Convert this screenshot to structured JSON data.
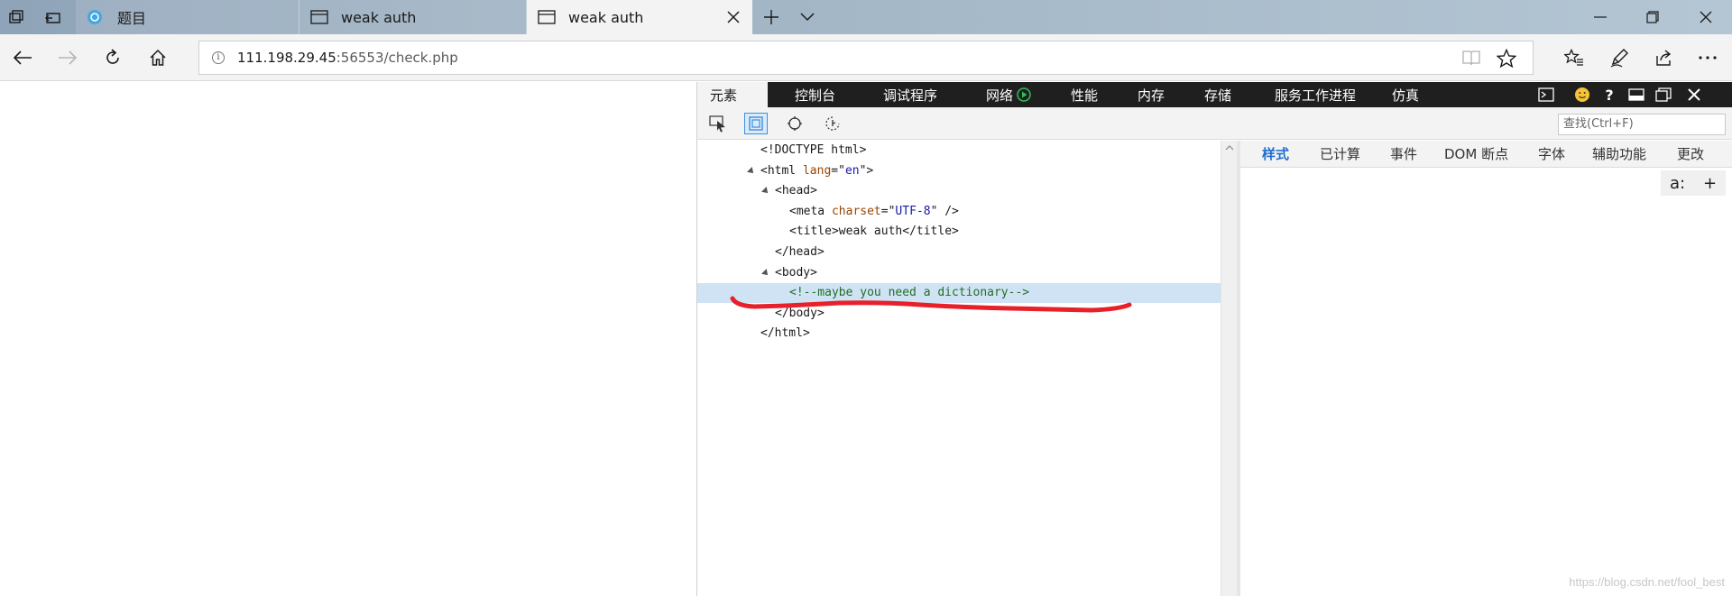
{
  "browser": {
    "tabs": [
      {
        "title": "题目",
        "active": false
      },
      {
        "title": "weak auth",
        "active": false
      },
      {
        "title": "weak auth",
        "active": true
      }
    ],
    "url_host": "111.198.29.45",
    "url_rest": ":56553/check.php",
    "window_controls": [
      "minimize-icon",
      "restore-icon",
      "close-icon"
    ]
  },
  "devtools": {
    "tabs": [
      "元素",
      "控制台",
      "调试程序",
      "网络",
      "性能",
      "内存",
      "存储",
      "服务工作进程",
      "仿真"
    ],
    "active_tab": "元素",
    "search_placeholder": "查找(Ctrl+F)",
    "dom": [
      {
        "indent": 0,
        "twisty": false,
        "parts": [
          [
            "tgb",
            "<!DOCTYPE html>"
          ]
        ]
      },
      {
        "indent": 0,
        "twisty": true,
        "parts": [
          [
            "tgb",
            "<html "
          ],
          [
            "at",
            "lang"
          ],
          [
            "tgb",
            "=\""
          ],
          [
            "av",
            "en"
          ],
          [
            "tgb",
            "\">"
          ]
        ]
      },
      {
        "indent": 1,
        "twisty": true,
        "parts": [
          [
            "tgb",
            "<head>"
          ]
        ]
      },
      {
        "indent": 2,
        "twisty": false,
        "parts": [
          [
            "tgb",
            "<meta "
          ],
          [
            "at",
            "charset"
          ],
          [
            "tgb",
            "=\""
          ],
          [
            "av",
            "UTF-8"
          ],
          [
            "tgb",
            "\" />"
          ]
        ]
      },
      {
        "indent": 2,
        "twisty": false,
        "parts": [
          [
            "tgb",
            "<title>"
          ],
          [
            "dt-text",
            "weak auth"
          ],
          [
            "tgb",
            "</title>"
          ]
        ]
      },
      {
        "indent": 1,
        "twisty": false,
        "parts": [
          [
            "tgb",
            "</head>"
          ]
        ]
      },
      {
        "indent": 1,
        "twisty": true,
        "parts": [
          [
            "tgb",
            "<body>"
          ]
        ]
      },
      {
        "indent": 2,
        "twisty": false,
        "highlight": true,
        "parts": [
          [
            "cm",
            "<!--maybe you need a dictionary-->"
          ]
        ]
      },
      {
        "indent": 1,
        "twisty": false,
        "parts": [
          [
            "tgb",
            "</body>"
          ]
        ]
      },
      {
        "indent": 0,
        "twisty": false,
        "parts": [
          [
            "tgb",
            "</html>"
          ]
        ]
      }
    ],
    "side_tabs": [
      "样式",
      "已计算",
      "事件",
      "DOM 断点",
      "字体",
      "辅助功能",
      "更改"
    ],
    "active_side_tab": "样式",
    "side_tools": [
      "a:",
      "+"
    ]
  },
  "watermark": "https://blog.csdn.net/fool_best",
  "colors": {
    "accent": "#1f6fd1",
    "annotation": "#e8202a",
    "highlight": "#cfe3f5"
  }
}
